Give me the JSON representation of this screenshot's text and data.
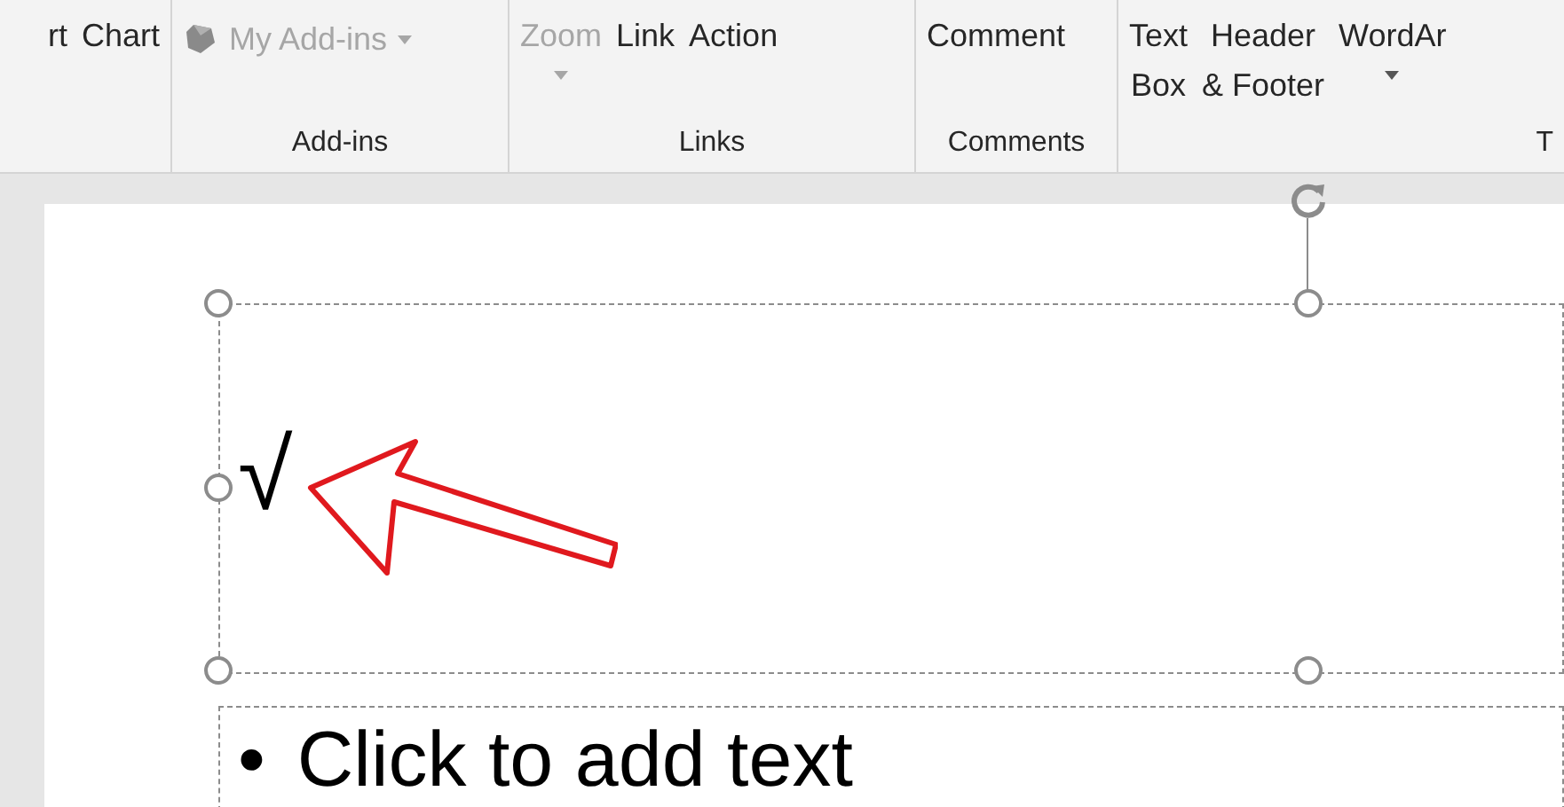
{
  "ribbon": {
    "groups": [
      {
        "buttons": [
          {
            "label": "rt",
            "disabled": false,
            "dropdown": false
          },
          {
            "label": "Chart",
            "disabled": false,
            "dropdown": false
          }
        ]
      },
      {
        "label": "Add-ins",
        "buttons": [
          {
            "label": "My Add-ins",
            "disabled": true,
            "dropdown": true,
            "kind": "inline"
          }
        ]
      },
      {
        "label": "Links",
        "buttons": [
          {
            "label": "Zoom",
            "disabled": true,
            "dropdown": true
          },
          {
            "label": "Link",
            "disabled": false,
            "dropdown": false
          },
          {
            "label": "Action",
            "disabled": false,
            "dropdown": false
          }
        ]
      },
      {
        "label": "Comments",
        "buttons": [
          {
            "label": "Comment",
            "disabled": false,
            "dropdown": false
          }
        ]
      },
      {
        "label": "T",
        "buttons": [
          {
            "label": "Text\nBox",
            "disabled": false,
            "dropdown": false
          },
          {
            "label": "Header\n& Footer",
            "disabled": false,
            "dropdown": false
          },
          {
            "label": "WordAr",
            "disabled": false,
            "dropdown": true
          }
        ]
      }
    ]
  },
  "slide": {
    "title_placeholder": {
      "text": "√",
      "selected": true
    },
    "body_placeholder": {
      "bullet": "•",
      "text": "Click to add text"
    }
  }
}
